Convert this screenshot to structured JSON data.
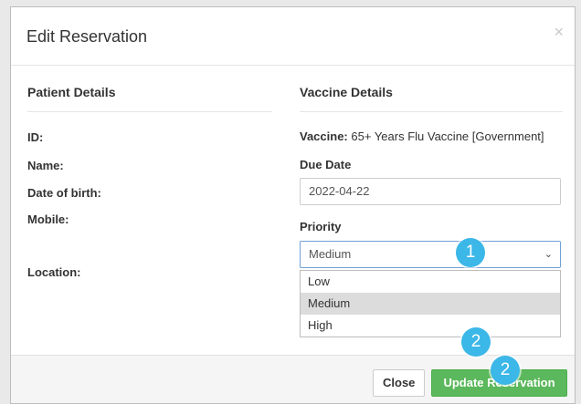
{
  "modal": {
    "title": "Edit Reservation",
    "close_glyph": "×"
  },
  "patient": {
    "heading": "Patient Details",
    "id_label": "ID:",
    "name_label": "Name:",
    "dob_label": "Date of birth:",
    "mobile_label": "Mobile:",
    "location_label": "Location:"
  },
  "vaccine": {
    "heading": "Vaccine Details",
    "vaccine_label": "Vaccine:",
    "vaccine_value": "65+ Years Flu Vaccine [Government]",
    "due_date_label": "Due Date",
    "due_date_value": "2022-04-22",
    "priority_label": "Priority",
    "priority_selected": "Medium",
    "priority_options": [
      "Low",
      "Medium",
      "High"
    ]
  },
  "footer": {
    "close_label": "Close",
    "update_label": "Update Reservation"
  },
  "annotations": {
    "badge_1": "1",
    "badge_2a": "2",
    "badge_2b": "2"
  },
  "colors": {
    "accent_badge": "#3bb7e8",
    "update_button": "#5cb85c",
    "selected_option": "#dcdcdc"
  }
}
